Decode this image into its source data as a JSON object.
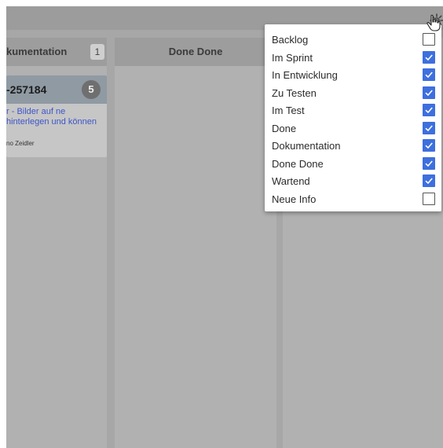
{
  "columns": [
    {
      "title": "kumentation",
      "count": "1"
    },
    {
      "title": "Done Done",
      "count": ""
    }
  ],
  "card": {
    "id": "-257184",
    "badge": "5",
    "title": "r - Bilder auf ne hinterlegen und können",
    "owner": "no Zeidler"
  },
  "settings_menu": {
    "items": [
      {
        "label": "Backlog",
        "checked": false
      },
      {
        "label": "Im Sprint",
        "checked": true
      },
      {
        "label": "In Entwicklung",
        "checked": true
      },
      {
        "label": "Zu Testen",
        "checked": true
      },
      {
        "label": "Im Test",
        "checked": true
      },
      {
        "label": "Done",
        "checked": true
      },
      {
        "label": "Dokumentation",
        "checked": true
      },
      {
        "label": "Done Done",
        "checked": true
      },
      {
        "label": "Wartend",
        "checked": true
      },
      {
        "label": "Neue Info",
        "checked": false
      }
    ]
  },
  "icons": {
    "settings": "gear-icon",
    "cursor": "hand-pointer-icon",
    "check": "checkmark-icon"
  },
  "colors": {
    "checkbox_checked": "#3d6fde",
    "card_title_link": "#3d55c9",
    "board_background": "#a7a7a7"
  }
}
